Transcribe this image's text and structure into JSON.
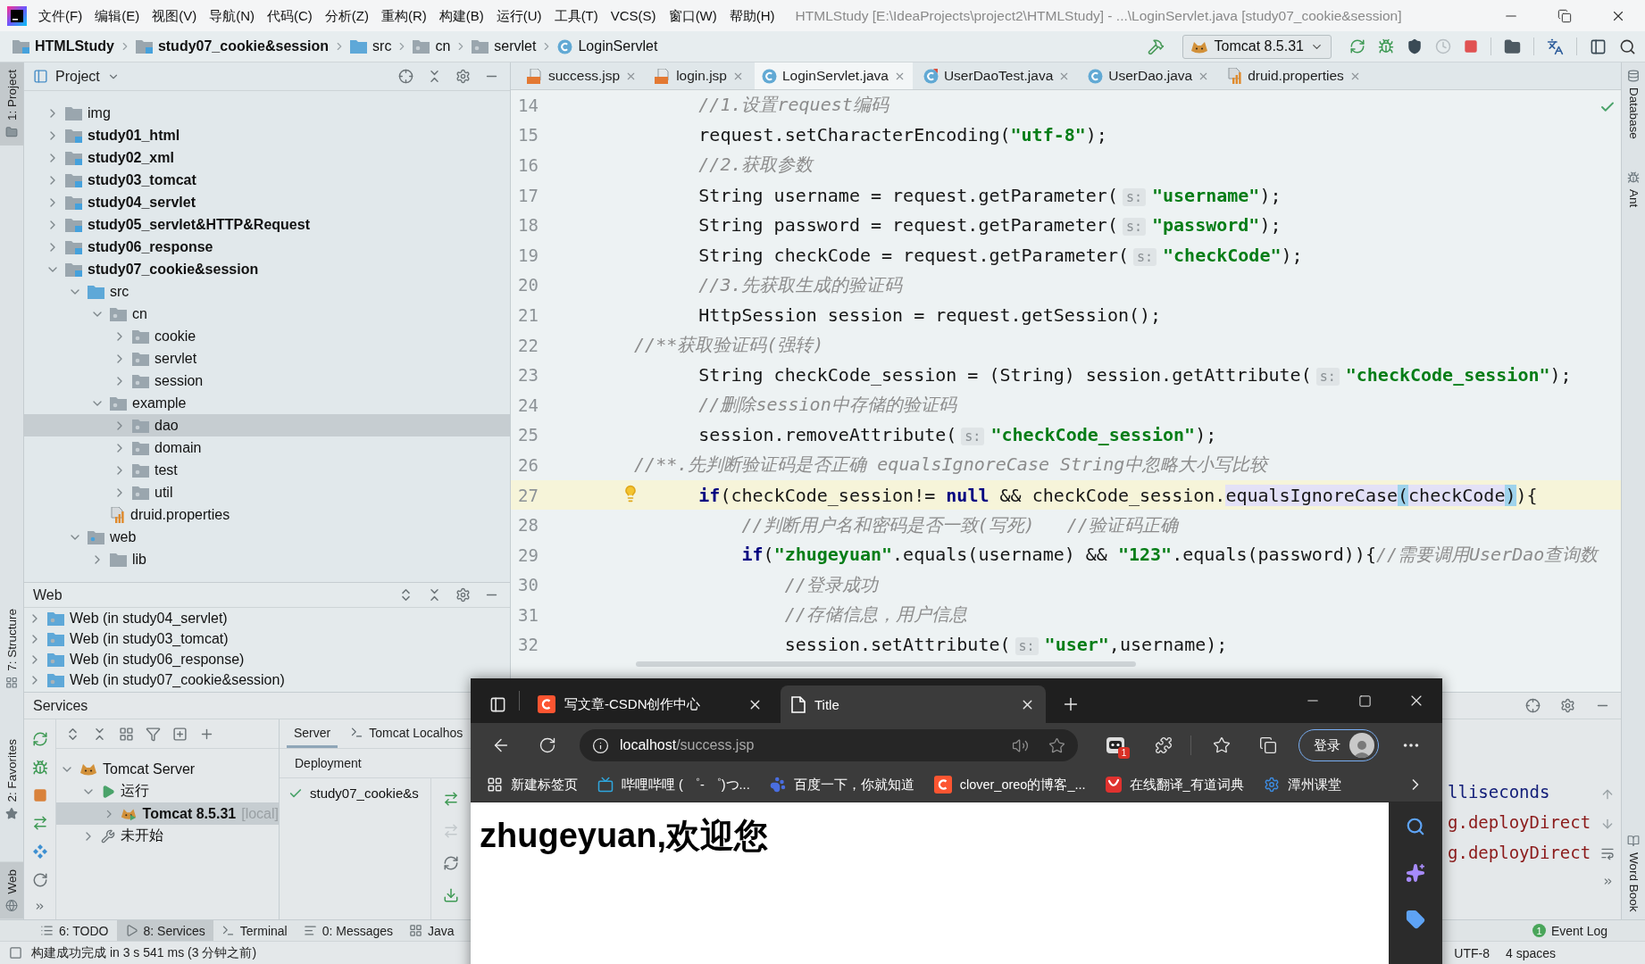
{
  "window": {
    "title": "HTMLStudy [E:\\IdeaProjects\\project2\\HTMLStudy] - ...\\LoginServlet.java [study07_cookie&session]"
  },
  "menu": [
    "文件(F)",
    "编辑(E)",
    "视图(V)",
    "导航(N)",
    "代码(C)",
    "分析(Z)",
    "重构(R)",
    "构建(B)",
    "运行(U)",
    "工具(T)",
    "VCS(S)",
    "窗口(W)",
    "帮助(H)"
  ],
  "breadcrumb": [
    {
      "label": "HTMLStudy",
      "kind": "module"
    },
    {
      "label": "study07_cookie&session",
      "kind": "module"
    },
    {
      "label": "src",
      "kind": "source"
    },
    {
      "label": "cn",
      "kind": "package"
    },
    {
      "label": "servlet",
      "kind": "package"
    },
    {
      "label": "LoginServlet",
      "kind": "class"
    }
  ],
  "run_config": {
    "label": "Tomcat 8.5.31"
  },
  "left_stripe": {
    "top": [
      {
        "label": "1: Project",
        "kind": "project",
        "selected": true
      }
    ],
    "bottom": [
      {
        "label": "7: Structure",
        "kind": "structure",
        "selected": false
      },
      {
        "label": "2: Favorites",
        "kind": "favorites",
        "selected": false
      },
      {
        "label": "Web",
        "kind": "web",
        "selected": true
      }
    ]
  },
  "right_stripe": {
    "top": [
      {
        "label": "Database",
        "kind": "database"
      },
      {
        "label": "Ant",
        "kind": "ant"
      }
    ],
    "bottom": [
      {
        "label": "Word Book",
        "kind": "book"
      }
    ]
  },
  "project_panel": {
    "title": "Project",
    "tree": [
      {
        "label": "img",
        "kind": "folder",
        "expanded": false,
        "selected": false
      },
      {
        "label": "study01_html",
        "kind": "module",
        "expanded": false,
        "selected": false
      },
      {
        "label": "study02_xml",
        "kind": "module",
        "expanded": false,
        "selected": false
      },
      {
        "label": "study03_tomcat",
        "kind": "module",
        "expanded": false,
        "selected": false
      },
      {
        "label": "study04_servlet",
        "kind": "module",
        "expanded": false,
        "selected": false
      },
      {
        "label": "study05_servlet&HTTP&Request",
        "kind": "module",
        "expanded": false,
        "selected": false
      },
      {
        "label": "study06_response",
        "kind": "module",
        "expanded": false,
        "selected": false
      },
      {
        "label": "study07_cookie&session",
        "kind": "module",
        "expanded": true,
        "selected": false,
        "children": [
          {
            "label": "src",
            "kind": "source",
            "expanded": true,
            "selected": false,
            "children": [
              {
                "label": "cn",
                "kind": "package",
                "expanded": true,
                "selected": false,
                "children": [
                  {
                    "label": "cookie",
                    "kind": "package",
                    "expanded": false,
                    "selected": false
                  },
                  {
                    "label": "servlet",
                    "kind": "package",
                    "expanded": false,
                    "selected": false
                  },
                  {
                    "label": "session",
                    "kind": "package",
                    "expanded": false,
                    "selected": false
                  }
                ]
              },
              {
                "label": "example",
                "kind": "package",
                "expanded": true,
                "selected": false,
                "children": [
                  {
                    "label": "dao",
                    "kind": "package",
                    "expanded": false,
                    "selected": true
                  },
                  {
                    "label": "domain",
                    "kind": "package",
                    "expanded": false,
                    "selected": false
                  },
                  {
                    "label": "test",
                    "kind": "package",
                    "expanded": false,
                    "selected": false
                  },
                  {
                    "label": "util",
                    "kind": "package",
                    "expanded": false,
                    "selected": false
                  }
                ]
              },
              {
                "label": "druid.properties",
                "kind": "properties",
                "selected": false
              }
            ]
          },
          {
            "label": "web",
            "kind": "web",
            "expanded": true,
            "selected": false,
            "children": [
              {
                "label": "lib",
                "kind": "folder",
                "expanded": false,
                "selected": false
              }
            ]
          }
        ]
      }
    ]
  },
  "web_panel": {
    "title": "Web",
    "items": [
      "Web (in study04_servlet)",
      "Web (in study03_tomcat)",
      "Web (in study06_response)",
      "Web (in study07_cookie&session)"
    ]
  },
  "editor": {
    "tabs": [
      {
        "label": "success.jsp",
        "kind": "jsp",
        "selected": false
      },
      {
        "label": "login.jsp",
        "kind": "jsp",
        "selected": false
      },
      {
        "label": "LoginServlet.java",
        "kind": "class",
        "selected": true
      },
      {
        "label": "UserDaoTest.java",
        "kind": "test",
        "selected": false
      },
      {
        "label": "UserDao.java",
        "kind": "class",
        "selected": false
      },
      {
        "label": "druid.properties",
        "kind": "properties",
        "selected": false
      }
    ],
    "lines": [
      {
        "number": "14",
        "current": false,
        "segments": [
          {
            "kind": "comment",
            "text": "        //1.设置request编码"
          }
        ]
      },
      {
        "number": "15",
        "current": false,
        "segments": [
          {
            "kind": "plain",
            "text": "        request.setCharacterEncoding("
          },
          {
            "kind": "string",
            "text": "\"utf-8\""
          },
          {
            "kind": "plain",
            "text": ");"
          }
        ]
      },
      {
        "number": "16",
        "current": false,
        "segments": [
          {
            "kind": "comment",
            "text": "        //2.获取参数"
          }
        ]
      },
      {
        "number": "17",
        "current": false,
        "segments": [
          {
            "kind": "plain",
            "text": "        String username = request.getParameter("
          },
          {
            "kind": "hint",
            "text": "s:"
          },
          {
            "kind": "string",
            "text": "\"username\""
          },
          {
            "kind": "plain",
            "text": ");"
          }
        ]
      },
      {
        "number": "18",
        "current": false,
        "segments": [
          {
            "kind": "plain",
            "text": "        String password = request.getParameter("
          },
          {
            "kind": "hint",
            "text": "s:"
          },
          {
            "kind": "string",
            "text": "\"password\""
          },
          {
            "kind": "plain",
            "text": ");"
          }
        ]
      },
      {
        "number": "19",
        "current": false,
        "segments": [
          {
            "kind": "plain",
            "text": "        String checkCode = request.getParameter("
          },
          {
            "kind": "hint",
            "text": "s:"
          },
          {
            "kind": "string",
            "text": "\"checkCode\""
          },
          {
            "kind": "plain",
            "text": ");"
          }
        ]
      },
      {
        "number": "20",
        "current": false,
        "segments": [
          {
            "kind": "comment",
            "text": "        //3.先获取生成的验证码"
          }
        ]
      },
      {
        "number": "21",
        "current": false,
        "segments": [
          {
            "kind": "plain",
            "text": "        HttpSession session = request.getSession();"
          }
        ]
      },
      {
        "number": "22",
        "current": false,
        "segments": [
          {
            "kind": "comment",
            "text": "  //**获取验证码(强转)"
          }
        ]
      },
      {
        "number": "23",
        "current": false,
        "segments": [
          {
            "kind": "plain",
            "text": "        String checkCode_session = (String) session.getAttribute("
          },
          {
            "kind": "hint",
            "text": "s:"
          },
          {
            "kind": "string",
            "text": "\"checkCode_session\""
          },
          {
            "kind": "plain",
            "text": ");"
          }
        ]
      },
      {
        "number": "24",
        "current": false,
        "segments": [
          {
            "kind": "comment",
            "text": "        //删除session中存储的验证码"
          }
        ]
      },
      {
        "number": "25",
        "current": false,
        "segments": [
          {
            "kind": "plain",
            "text": "        session.removeAttribute("
          },
          {
            "kind": "hint",
            "text": "s:"
          },
          {
            "kind": "string",
            "text": "\"checkCode_session\""
          },
          {
            "kind": "plain",
            "text": ");"
          }
        ]
      },
      {
        "number": "26",
        "current": false,
        "segments": [
          {
            "kind": "comment",
            "text": "  //**.先判断验证码是否正确 equalsIgnoreCase String中忽略大小写比较"
          }
        ]
      },
      {
        "number": "27",
        "current": true,
        "segments": [
          {
            "kind": "keyword",
            "text": "        if"
          },
          {
            "kind": "plain",
            "text": "(checkCode_session!= "
          },
          {
            "kind": "keyword",
            "text": "null"
          },
          {
            "kind": "plain",
            "text": " && checkCode_session."
          },
          {
            "kind": "usage",
            "text": "equalsIgnoreCase"
          },
          {
            "kind": "match",
            "text": "("
          },
          {
            "kind": "usage",
            "text": "checkCode"
          },
          {
            "kind": "match",
            "text": ")"
          },
          {
            "kind": "plain",
            "text": "){"
          }
        ]
      },
      {
        "number": "28",
        "current": false,
        "segments": [
          {
            "kind": "comment",
            "text": "            //判断用户名和密码是否一致(写死)   //验证码正确"
          }
        ]
      },
      {
        "number": "29",
        "current": false,
        "segments": [
          {
            "kind": "keyword",
            "text": "            if"
          },
          {
            "kind": "plain",
            "text": "("
          },
          {
            "kind": "string",
            "text": "\"zhugeyuan\""
          },
          {
            "kind": "plain",
            "text": ".equals(username) && "
          },
          {
            "kind": "string",
            "text": "\"123\""
          },
          {
            "kind": "plain",
            "text": ".equals(password)){"
          },
          {
            "kind": "comment",
            "text": "//需要调用UserDao查询数"
          }
        ]
      },
      {
        "number": "30",
        "current": false,
        "segments": [
          {
            "kind": "comment",
            "text": "                //登录成功"
          }
        ]
      },
      {
        "number": "31",
        "current": false,
        "segments": [
          {
            "kind": "comment",
            "text": "                //存储信息，用户信息"
          }
        ]
      },
      {
        "number": "32",
        "current": false,
        "segments": [
          {
            "kind": "plain",
            "text": "                session.setAttribute("
          },
          {
            "kind": "hint",
            "text": "s:"
          },
          {
            "kind": "string",
            "text": "\"user\""
          },
          {
            "kind": "plain",
            "text": ",username);"
          }
        ]
      }
    ]
  },
  "services_panel": {
    "title": "Services",
    "tree": [
      {
        "label": "Tomcat Server",
        "kind": "server",
        "expanded": true,
        "selected": false,
        "children": [
          {
            "label": "运行",
            "kind": "running",
            "expanded": true,
            "selected": false,
            "children": [
              {
                "label": "Tomcat 8.5.31",
                "note": "[local]",
                "kind": "tomcat",
                "expanded": false,
                "selected": true
              }
            ]
          },
          {
            "label": "未开始",
            "kind": "idle",
            "expanded": false,
            "selected": false
          }
        ]
      }
    ],
    "detail_tabs": [
      {
        "label": "Server",
        "selected": true
      },
      {
        "label": "Tomcat Localhos",
        "selected": false
      }
    ],
    "deployment": {
      "title": "Deployment",
      "items": [
        {
          "label": "study07_cookie&s",
          "deployed": true
        }
      ]
    },
    "console": [
      {
        "text": "lliseconds",
        "kind": "info"
      },
      {
        "text": "g.deployDirect",
        "kind": "error"
      },
      {
        "text": "g.deployDirect",
        "kind": "error"
      }
    ]
  },
  "tool_window_bar": {
    "tabs": [
      {
        "label": "6: TODO",
        "kind": "todo",
        "selected": false
      },
      {
        "label": "8: Services",
        "kind": "services",
        "selected": true
      },
      {
        "label": "Terminal",
        "kind": "terminal",
        "selected": false
      },
      {
        "label": "0: Messages",
        "kind": "messages",
        "selected": false
      },
      {
        "label": "Java",
        "kind": "java",
        "selected": false
      }
    ],
    "event_log": {
      "label": "Event Log",
      "badge": "1"
    }
  },
  "status_bar": {
    "message": "构建成功完成 in 3 s 541 ms (3 分钟之前)",
    "encoding": "UTF-8",
    "indent": "4 spaces"
  },
  "browser": {
    "tabs": [
      {
        "title": "写文章-CSDN创作中心",
        "kind": "csdn",
        "selected": false
      },
      {
        "title": "Title",
        "kind": "page",
        "selected": true
      }
    ],
    "address": {
      "host": "localhost",
      "path": "/success.jsp"
    },
    "extension_badge": "1",
    "sign_in": "登录",
    "bookmarks": [
      {
        "label": "新建标签页",
        "kind": "newtab"
      },
      {
        "label": "哔哩哔哩 ( ゜- ゜)つ...",
        "kind": "bilibili"
      },
      {
        "label": "百度一下，你就知道",
        "kind": "baidu"
      },
      {
        "label": "clover_oreo的博客_...",
        "kind": "csdn"
      },
      {
        "label": "在线翻译_有道词典",
        "kind": "youdao"
      },
      {
        "label": "潭州课堂",
        "kind": "tanzhou"
      }
    ],
    "page": {
      "heading": "zhugeyuan,欢迎您"
    }
  }
}
